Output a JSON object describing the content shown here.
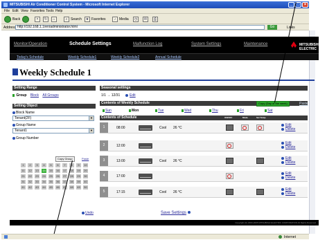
{
  "window": {
    "title": "MITSUBISHI Air Conditioner Control System - Microsoft Internet Explorer",
    "menu": [
      "File",
      "Edit",
      "View",
      "Favorites",
      "Tools",
      "Help"
    ]
  },
  "toolbar": {
    "back": "Back",
    "search": "Search",
    "favorites": "Favorites",
    "media": "Media"
  },
  "address": {
    "label": "Address",
    "url": "http://192.168.1.1/en/administrator.html",
    "go": "Go",
    "links": "Links"
  },
  "header": {
    "nav": [
      "Monitor/Operation",
      "Schedule Settings",
      "Malfunction Log",
      "System Settings",
      "Maintenance"
    ],
    "active_nav": "Schedule Settings",
    "subnav": [
      "Today's Schedule",
      "Weekly Schedule1",
      "Weekly Schedule2",
      "Annual Schedule"
    ],
    "logo": "MITSUBISHI ELECTRIC",
    "brand_color": "#e60012"
  },
  "page": {
    "title": "Weekly Schedule 1"
  },
  "setting_range": {
    "heading": "Setting Range",
    "options": [
      "Group",
      "Block",
      "All Groups"
    ]
  },
  "setting_object": {
    "heading": "Setting Object",
    "block_name_label": "Block Name",
    "block_name_value": "Tenant(2F)",
    "group_name_label": "Group Name",
    "group_name_value": "Tenant1",
    "group_number_label": "Group Number",
    "copy_button": "Copy Group",
    "paste_button": "Paste",
    "group_numbers": [
      "1",
      "2",
      "3",
      "4",
      "5",
      "6",
      "7",
      "8",
      "9",
      "10",
      "11",
      "12",
      "13",
      "14",
      "15",
      "16",
      "17",
      "18",
      "19",
      "20",
      "21",
      "22",
      "23",
      "24",
      "25",
      "26",
      "27",
      "28",
      "29",
      "30",
      "31",
      "32",
      "33",
      "34",
      "35",
      "36",
      "37",
      "38",
      "39",
      "40",
      "41",
      "42",
      "43",
      "44",
      "45",
      "46",
      "47",
      "48",
      "49",
      "50"
    ],
    "selected_group": "14"
  },
  "seasonal": {
    "heading": "Seasonal settings",
    "range": "1/1 → 12/31",
    "edit": "Edit"
  },
  "weekly": {
    "heading": "Contents of Weekly Schedule",
    "copy_button": "Copy (Day of the week)",
    "paste": "Paste",
    "days": [
      "Sun",
      "Mon",
      "Tue",
      "Wed",
      "Thu",
      "Fri",
      "Sat"
    ],
    "active_day": "Mon"
  },
  "schedule": {
    "heading": "Contents of Schedule",
    "col_onoff": "ON/OFF",
    "col_mode": "Mode",
    "col_settemp": "Set Temp.",
    "edit": "Edit",
    "delete": "Delete",
    "rows": [
      {
        "num": "1",
        "time": "08:00",
        "mode": "Cool",
        "temp": "26 °C"
      },
      {
        "num": "2",
        "time": "12:00",
        "mode": "",
        "temp": ""
      },
      {
        "num": "3",
        "time": "13:00",
        "mode": "Cool",
        "temp": "26 °C"
      },
      {
        "num": "4",
        "time": "17:00",
        "mode": "",
        "temp": ""
      },
      {
        "num": "5",
        "time": "17:15",
        "mode": "Cool",
        "temp": "26 °C"
      }
    ]
  },
  "bottom": {
    "undo": "Undo",
    "save": "Save Settings"
  },
  "footer": {
    "copyright": "Copyright (C) 2003-2005 MITSUBISHI ELECTRIC CORPORATION All Rights Reserved"
  },
  "status": {
    "zone": "Internet"
  }
}
